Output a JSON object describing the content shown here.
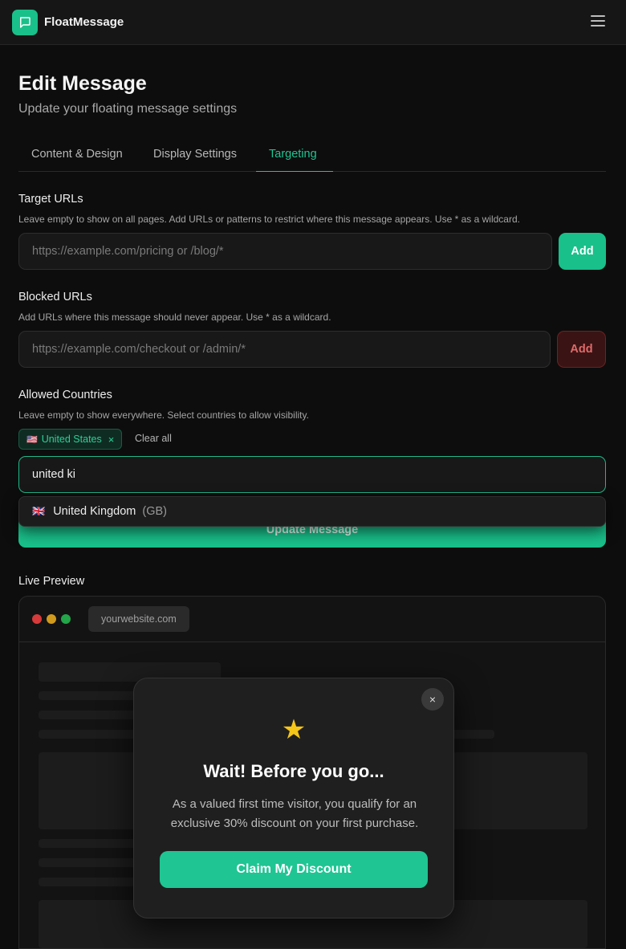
{
  "app": {
    "name": "FloatMessage"
  },
  "page": {
    "title": "Edit Message",
    "subtitle": "Update your floating message settings"
  },
  "tabs": [
    {
      "label": "Content & Design",
      "active": false
    },
    {
      "label": "Display Settings",
      "active": false
    },
    {
      "label": "Targeting",
      "active": true
    }
  ],
  "target_urls": {
    "label": "Target URLs",
    "help": "Leave empty to show on all pages. Add URLs or patterns to restrict where this message appears. Use * as a wildcard.",
    "placeholder": "https://example.com/pricing or /blog/*",
    "value": "",
    "add_label": "Add"
  },
  "blocked_urls": {
    "label": "Blocked URLs",
    "help": "Add URLs where this message should never appear. Use * as a wildcard.",
    "placeholder": "https://example.com/checkout or /admin/*",
    "value": "",
    "add_label": "Add"
  },
  "allowed_countries": {
    "label": "Allowed Countries",
    "help": "Leave empty to show everywhere. Select countries to allow visibility.",
    "selected": [
      {
        "flag": "🇺🇸",
        "name": "United States",
        "remove": "×"
      }
    ],
    "clear_all": "Clear all",
    "search_value": "united ki",
    "suggestions": [
      {
        "flag": "🇬🇧",
        "name": "United Kingdom",
        "code": "(GB)"
      }
    ]
  },
  "update_button": "Update Message",
  "preview": {
    "label": "Live Preview",
    "url": "yourwebsite.com",
    "dots": [
      "#d63a3a",
      "#d19a1c",
      "#23a54a"
    ],
    "modal": {
      "close": "×",
      "icon": "★",
      "title": "Wait! Before you go...",
      "text": "As a valued first time visitor, you qualify for an exclusive 30% discount on your first purchase.",
      "cta": "Claim My Discount"
    }
  },
  "colors": {
    "accent": "#19c08a",
    "danger": "#e06a6a",
    "background": "#0d0d0d"
  }
}
